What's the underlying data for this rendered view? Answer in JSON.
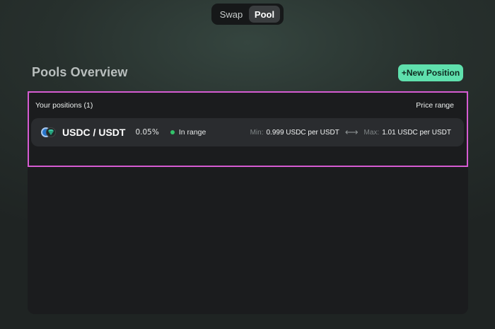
{
  "toggle": {
    "swap_label": "Swap",
    "pool_label": "Pool",
    "active": "Pool"
  },
  "header": {
    "title": "Pools Overview",
    "new_position_label": "+New Position"
  },
  "positions": {
    "heading": "Your positions (1)",
    "price_range_label": "Price range",
    "items": [
      {
        "pair": "USDC / USDT",
        "fee": "0.05%",
        "status": "In range",
        "min_label": "Min:",
        "min_value": "0.999 USDC per USDT",
        "arrow": "⟷",
        "max_label": "Max:",
        "max_value": "1.01 USDC per USDT"
      }
    ]
  },
  "colors": {
    "accent": "#5fe0ad",
    "status_in_range": "#33c26a",
    "highlight_border": "#d65bd2",
    "panel_bg": "#1b1c1e"
  }
}
